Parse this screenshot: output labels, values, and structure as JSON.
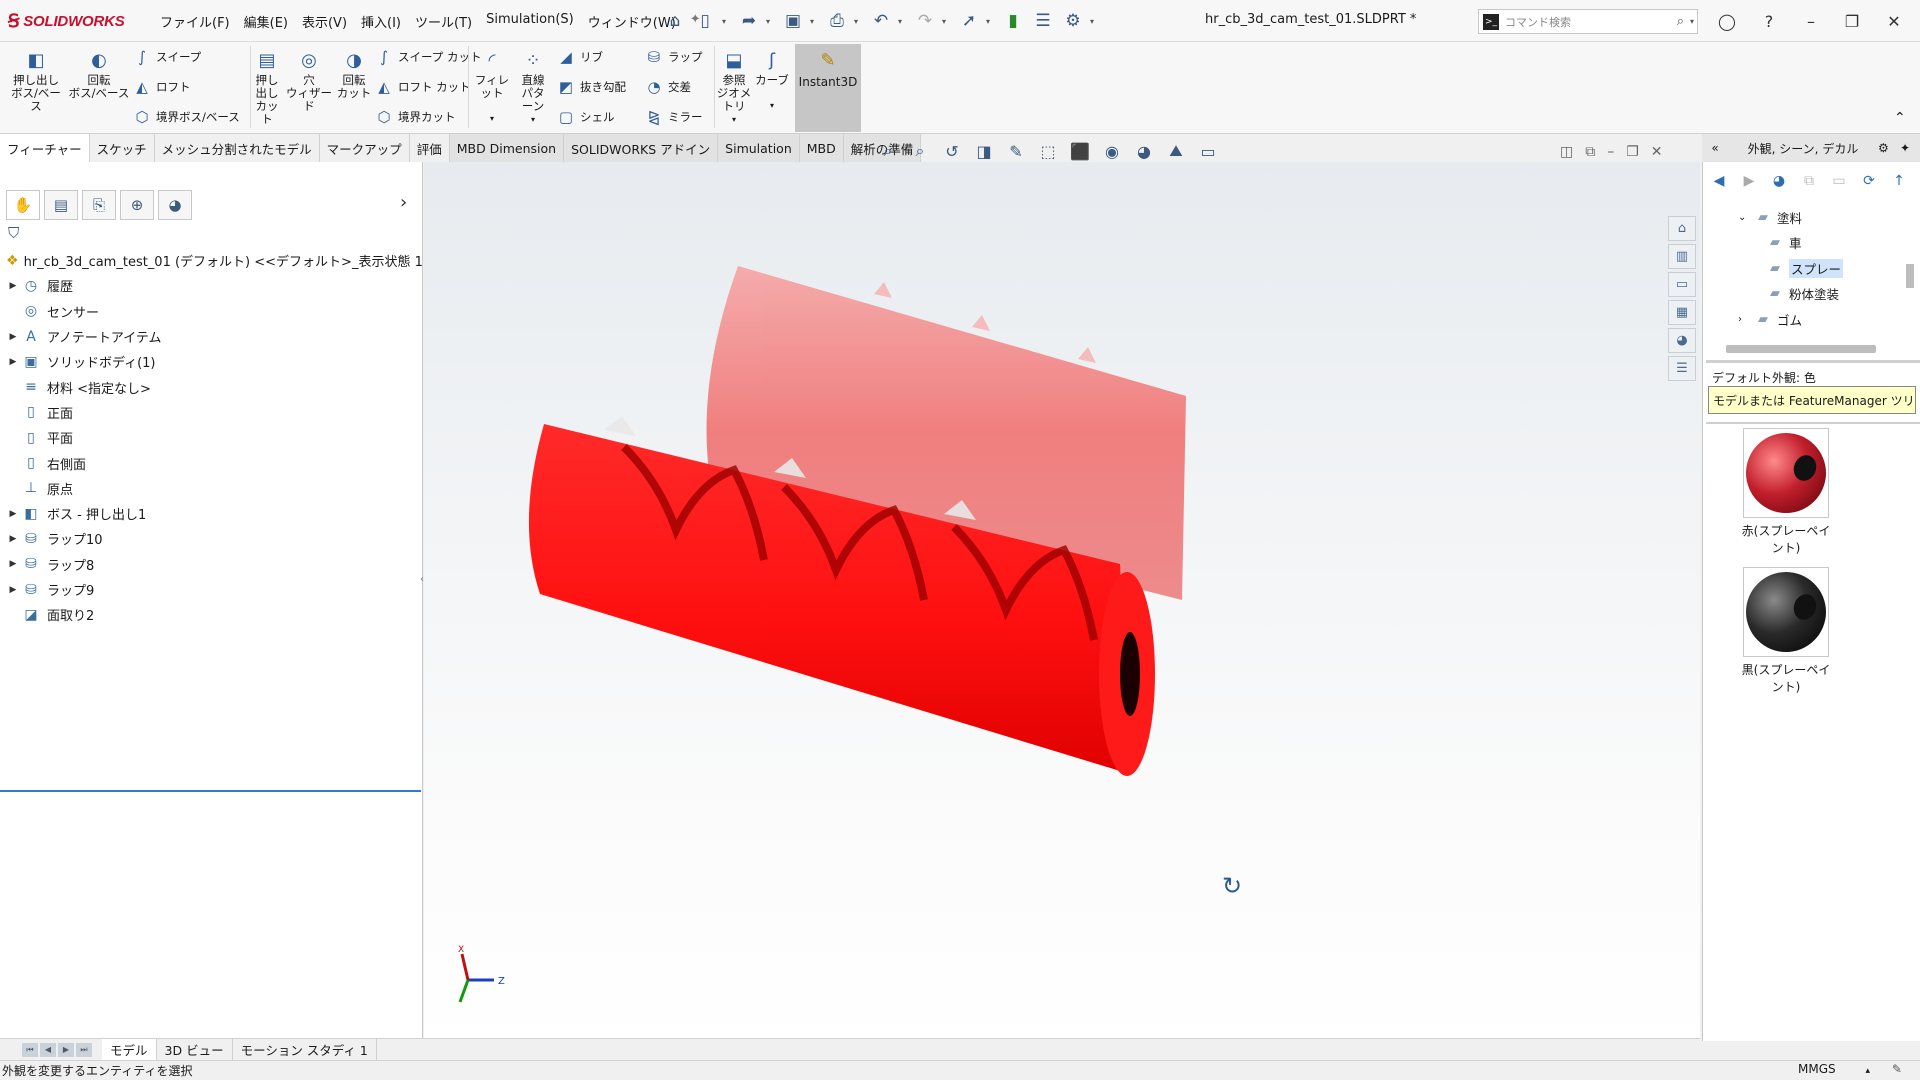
{
  "app": {
    "name": "SOLIDWORKS",
    "document_title": "hr_cb_3d_cam_test_01.SLDPRT *",
    "accent": "#c8102e"
  },
  "menus": [
    "ファイル(F)",
    "編集(E)",
    "表示(V)",
    "挿入(I)",
    "ツール(T)",
    "Simulation(S)",
    "ウィンドウ(W)"
  ],
  "command_search": {
    "placeholder": "コマンド検索"
  },
  "ribbon": {
    "extrude_boss": "押し出し\nボス/ベース",
    "revolve_boss": "回転\nボス/ベース",
    "sweep": "スイープ",
    "loft": "ロフト",
    "boundary_boss": "境界ボス/ベース",
    "extrude_cut": "押し\n出し\nカット",
    "hole_wizard": "穴\nウィザード",
    "revolve_cut": "回転\nカット",
    "sweep_cut": "スイープ カット",
    "loft_cut": "ロフト カット",
    "boundary_cut": "境界カット",
    "fillet": "フィレット",
    "linear_pattern": "直線\nパターン",
    "rib": "リブ",
    "draft": "抜き勾配",
    "shell": "シェル",
    "wrap": "ラップ",
    "intersect": "交差",
    "mirror": "ミラー",
    "ref_geometry": "参照\nジオメトリ",
    "curves": "カーブ",
    "instant3d": "Instant3D"
  },
  "command_tabs": [
    "フィーチャー",
    "スケッチ",
    "メッシュ分割されたモデル",
    "マークアップ",
    "評価",
    "MBD Dimension",
    "SOLIDWORKS アドイン",
    "Simulation",
    "MBD",
    "解析の準備"
  ],
  "feature_tree": [
    {
      "label": "hr_cb_3d_cam_test_01 (デフォルト) <<デフォルト>_表示状態 1>",
      "icon": "part-icon",
      "expand": false,
      "root": true
    },
    {
      "label": "履歴",
      "icon": "history-icon",
      "expand": true
    },
    {
      "label": "センサー",
      "icon": "sensor-icon",
      "expand": false
    },
    {
      "label": "アノテートアイテム",
      "icon": "annotation-icon",
      "expand": true
    },
    {
      "label": "ソリッドボディ(1)",
      "icon": "solid-body-icon",
      "expand": true
    },
    {
      "label": "材料 <指定なし>",
      "icon": "material-icon",
      "expand": false
    },
    {
      "label": "正面",
      "icon": "plane-icon",
      "expand": false
    },
    {
      "label": "平面",
      "icon": "plane-icon",
      "expand": false
    },
    {
      "label": "右側面",
      "icon": "plane-icon",
      "expand": false
    },
    {
      "label": "原点",
      "icon": "origin-icon",
      "expand": false
    },
    {
      "label": "ボス - 押し出し1",
      "icon": "extrude-feature-icon",
      "expand": true
    },
    {
      "label": "ラップ10",
      "icon": "wrap-feature-icon",
      "expand": true
    },
    {
      "label": "ラップ8",
      "icon": "wrap-feature-icon",
      "expand": true
    },
    {
      "label": "ラップ9",
      "icon": "wrap-feature-icon",
      "expand": true
    },
    {
      "label": "面取り2",
      "icon": "chamfer-feature-icon",
      "expand": false
    }
  ],
  "task_pane": {
    "title": "外観, シーン, デカル",
    "tree": [
      {
        "label": "塗料",
        "level": 1,
        "expand": "open"
      },
      {
        "label": "車",
        "level": 2
      },
      {
        "label": "スプレー",
        "level": 2,
        "selected": true
      },
      {
        "label": "粉体塗装",
        "level": 2
      },
      {
        "label": "ゴム",
        "level": 1,
        "expand": "closed"
      }
    ],
    "default_appearance_label": "デフォルト外観: 色",
    "tooltip": "モデルまたは FeatureManager ツリーに...",
    "swatches": [
      {
        "label": "赤(スプレーペイント)",
        "color": "#c21f2c"
      },
      {
        "label": "黒(スプレーペイント)",
        "color": "#2a2a2a"
      }
    ]
  },
  "bottom_tabs": [
    "モデル",
    "3D ビュー",
    "モーション スタディ 1"
  ],
  "status": {
    "message": "外観を変更するエンティティを選択",
    "units": "MMGS"
  },
  "model": {
    "color": "#ff1a1a",
    "ghost_color": "#f26b6b"
  }
}
